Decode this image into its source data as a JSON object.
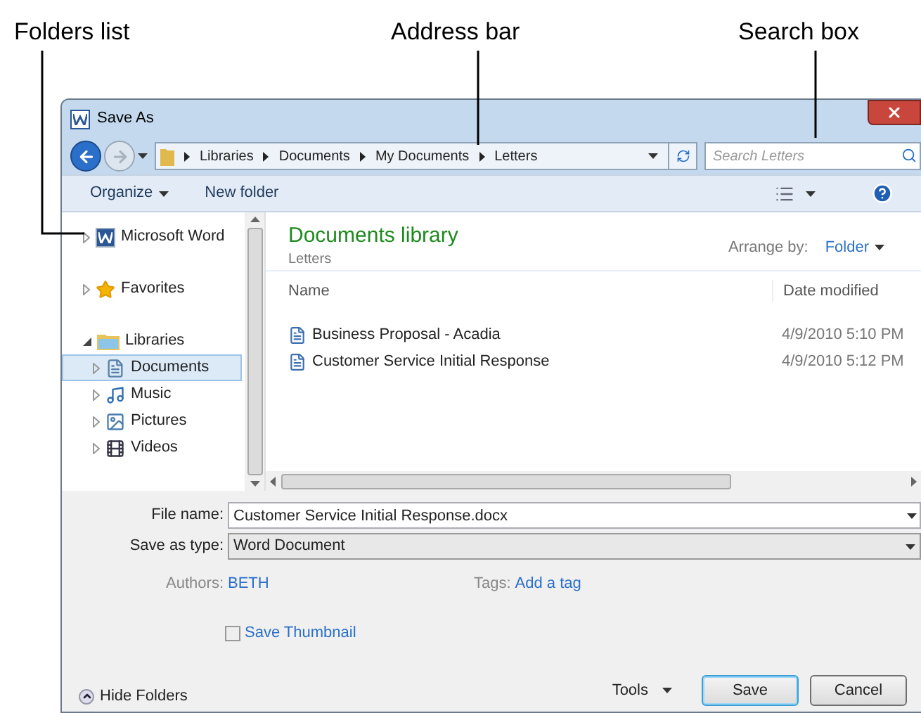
{
  "callouts": [
    {
      "label": "Folders list"
    },
    {
      "label": "Address bar"
    },
    {
      "label": "Search box"
    }
  ],
  "window": {
    "title": "Save As"
  },
  "address_bar": {
    "crumbs": [
      "Libraries",
      "Documents",
      "My Documents",
      "Letters"
    ]
  },
  "search": {
    "placeholder": "Search Letters"
  },
  "toolbar": {
    "items": [
      {
        "label": "Organize",
        "dropdown": true
      },
      {
        "label": "New folder",
        "dropdown": false
      }
    ]
  },
  "folders": [
    {
      "label": "Microsoft Word",
      "kind": "word",
      "expanded": false,
      "selected": false
    },
    {
      "label": "Favorites",
      "kind": "favorites",
      "expanded": false,
      "selected": false
    },
    {
      "label": "Libraries",
      "kind": "library",
      "expanded": true,
      "selected": false,
      "children": [
        {
          "label": "Documents",
          "kind": "documents",
          "expanded": false,
          "selected": true
        },
        {
          "label": "Music",
          "kind": "music",
          "expanded": false,
          "selected": false
        },
        {
          "label": "Pictures",
          "kind": "pictures",
          "expanded": false,
          "selected": false
        },
        {
          "label": "Videos",
          "kind": "videos",
          "expanded": false,
          "selected": false
        }
      ]
    }
  ],
  "library": {
    "title": "Documents library",
    "subtitle": "Letters",
    "arrange_label": "Arrange by:",
    "arrange_value": "Folder"
  },
  "table": {
    "columns": [
      "Name",
      "Date modified"
    ],
    "rows": [
      {
        "name": "Business Proposal - Acadia",
        "date": "4/9/2010 5:10 PM"
      },
      {
        "name": "Customer Service Initial Response",
        "date": "4/9/2010 5:12 PM"
      }
    ]
  },
  "form": {
    "file_name_label": "File name:",
    "file_name": "Customer Service Initial Response.docx",
    "type_label": "Save as type:",
    "type": "Word Document",
    "authors_label": "Authors:",
    "authors": "BETH",
    "tags_label": "Tags:",
    "tags": "Add a tag",
    "thumbnail": {
      "label": "Save Thumbnail",
      "checked": false
    }
  },
  "footer": {
    "hide_folders": "Hide Folders",
    "tools": "Tools",
    "buttons": [
      {
        "label": "Save",
        "default": true
      },
      {
        "label": "Cancel",
        "default": false
      }
    ]
  }
}
